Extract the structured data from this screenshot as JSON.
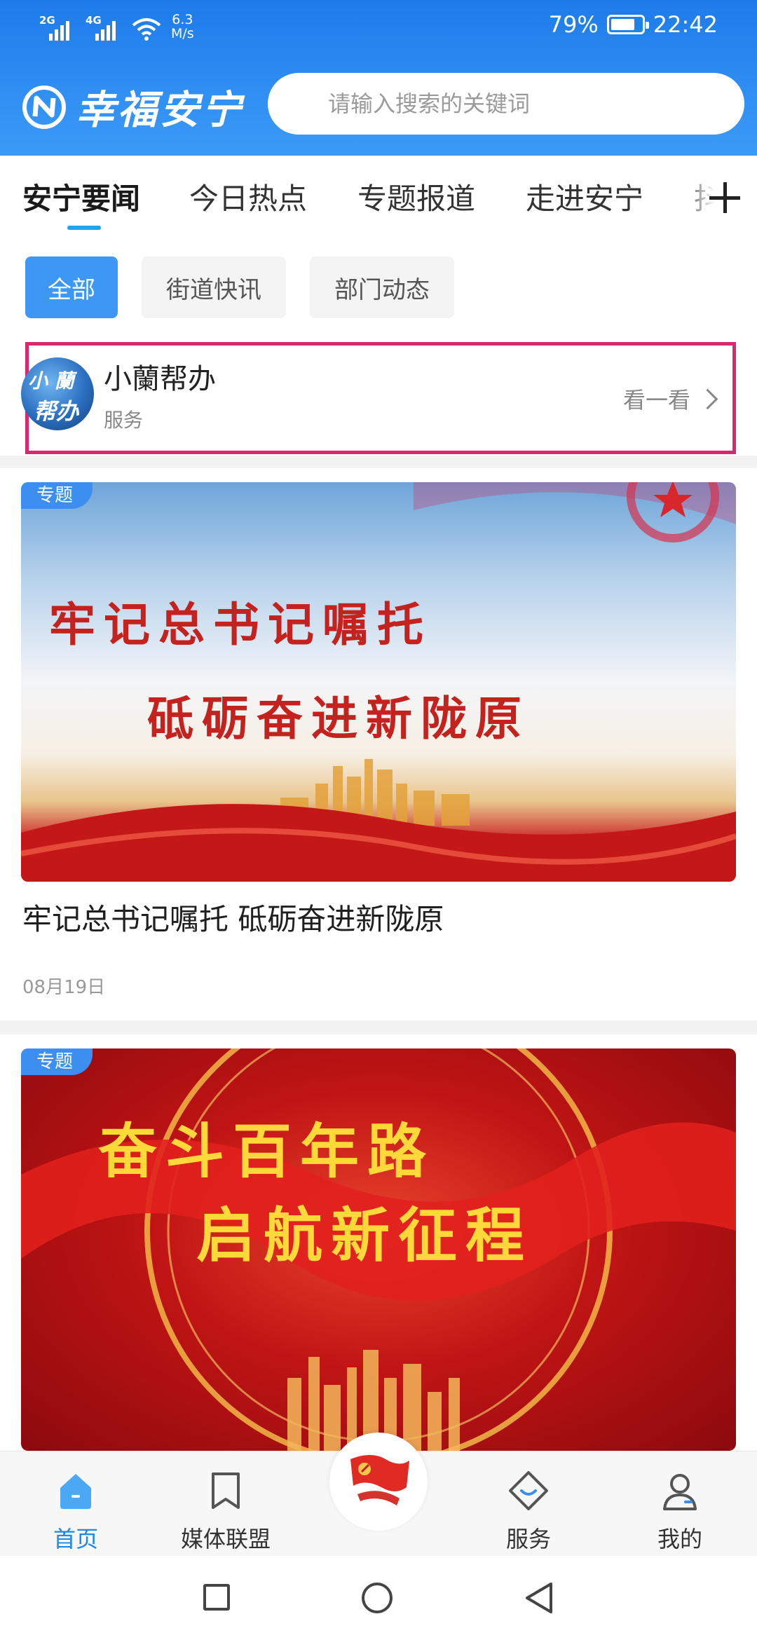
{
  "status_bar": {
    "signal1_label": "2G",
    "signal2_label": "4G",
    "net_speed_value": "6.3",
    "net_speed_unit": "M/s",
    "battery_percent": "79%",
    "battery_level": 0.79,
    "time": "22:42"
  },
  "header": {
    "app_name": "幸福安宁",
    "search_placeholder": "请输入搜索的关键词",
    "brand_color": "#2f8ff3"
  },
  "channel_tabs": {
    "items": [
      "安宁要闻",
      "今日热点",
      "专题报道",
      "走进安宁",
      "抖"
    ],
    "active_index": 0,
    "add_icon": "plus-icon"
  },
  "filters": {
    "items": [
      "全部",
      "街道快讯",
      "部门动态"
    ],
    "active_index": 0
  },
  "service": {
    "avatar_text": "小蘭帮办",
    "name": "小蘭帮办",
    "subtitle": "服务",
    "more_label": "看一看",
    "highlight_color": "#d8286f"
  },
  "articles": [
    {
      "badge": "专题",
      "poster_line1": "牢记总书记嘱托",
      "poster_line2": "砥砺奋进新陇原",
      "title": "牢记总书记嘱托 砥砺奋进新陇原",
      "date": "08月19日"
    },
    {
      "badge": "专题",
      "poster_line1": "奋斗百年路",
      "poster_line2": "启航新征程"
    }
  ],
  "bottom_nav": {
    "items": [
      {
        "label": "首页",
        "icon": "home-icon"
      },
      {
        "label": "媒体联盟",
        "icon": "bookmark-icon"
      },
      {
        "label": "",
        "icon": "party-flag-icon"
      },
      {
        "label": "服务",
        "icon": "service-icon"
      },
      {
        "label": "我的",
        "icon": "user-icon"
      }
    ],
    "active_index": 0,
    "active_color": "#1e88e5"
  }
}
